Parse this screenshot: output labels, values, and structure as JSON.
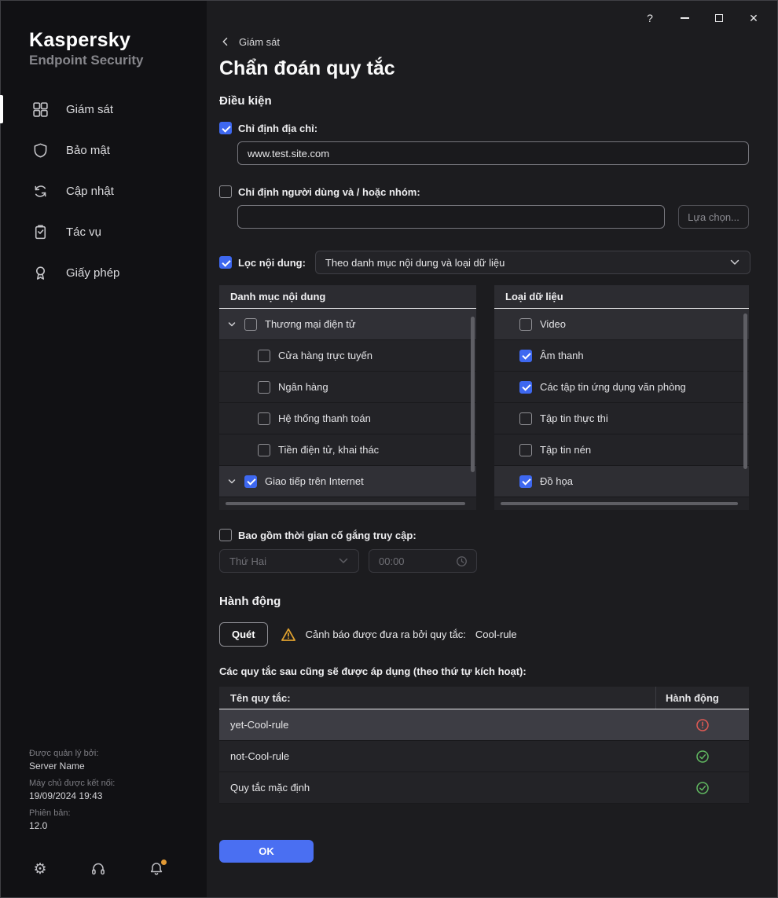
{
  "colors": {
    "accent": "#3e68f0",
    "ok_button": "#4a6ff2",
    "warning": "#dfa12f",
    "error": "#e05a54",
    "success": "#61b861",
    "notification_dot": "#e39a35"
  },
  "window_controls": {
    "help": "?"
  },
  "sidebar": {
    "brand_line1": "Kaspersky",
    "brand_line2": "Endpoint Security",
    "items": [
      {
        "label": "Giám sát"
      },
      {
        "label": "Bảo mật"
      },
      {
        "label": "Cập nhật"
      },
      {
        "label": "Tác vụ"
      },
      {
        "label": "Giấy phép"
      }
    ],
    "footer": {
      "managed_by_label": "Được quản lý bởi:",
      "managed_by_value": "Server Name",
      "server_label": "Máy chủ được kết nối:",
      "server_value": "19/09/2024 19:43",
      "version_label": "Phiên bản:",
      "version_value": "12.0"
    }
  },
  "main": {
    "breadcrumb": "Giám sát",
    "title": "Chẩn đoán quy tắc",
    "conditions": {
      "heading": "Điều kiện",
      "address_label": "Chỉ định địa chỉ:",
      "address_value": "www.test.site.com",
      "users_label": "Chỉ định người dùng và / hoặc nhóm:",
      "users_value": "",
      "choose_button": "Lựa chọn...",
      "filter_label": "Lọc nội dung:",
      "filter_value": "Theo danh mục nội dung và loại dữ liệu",
      "categories_panel": {
        "header": "Danh mục nội dung",
        "rows": [
          {
            "label": "Thương mại điện tử",
            "checked": false,
            "group": true
          },
          {
            "label": "Cửa hàng trực tuyến",
            "checked": false
          },
          {
            "label": "Ngân hàng",
            "checked": false
          },
          {
            "label": "Hệ thống thanh toán",
            "checked": false
          },
          {
            "label": "Tiền điện tử, khai thác",
            "checked": false
          },
          {
            "label": "Giao tiếp trên Internet",
            "checked": true,
            "group": true
          }
        ]
      },
      "datatypes_panel": {
        "header": "Loại dữ liệu",
        "rows": [
          {
            "label": "Video",
            "checked": false
          },
          {
            "label": "Âm thanh",
            "checked": true
          },
          {
            "label": "Các tập tin ứng dụng văn phòng",
            "checked": true
          },
          {
            "label": "Tập tin thực thi",
            "checked": false
          },
          {
            "label": "Tập tin nén",
            "checked": false
          },
          {
            "label": "Đồ họa",
            "checked": true
          }
        ]
      },
      "time_label": "Bao gồm thời gian cố gắng truy cập:",
      "day_value": "Thứ Hai",
      "time_value": "00:00"
    },
    "action": {
      "heading": "Hành động",
      "scan_button": "Quét",
      "warning_text": "Cảnh báo được đưa ra bởi quy tắc:",
      "warning_rule": "Cool-rule",
      "rules_caption": "Các quy tắc sau cũng sẽ được áp dụng (theo thứ tự kích hoạt):",
      "table": {
        "name_header": "Tên quy tắc:",
        "action_header": "Hành động",
        "rows": [
          {
            "name": "yet-Cool-rule",
            "status": "error"
          },
          {
            "name": "not-Cool-rule",
            "status": "ok"
          },
          {
            "name": "Quy tắc mặc định",
            "status": "ok"
          }
        ]
      },
      "ok_button": "OK"
    }
  }
}
